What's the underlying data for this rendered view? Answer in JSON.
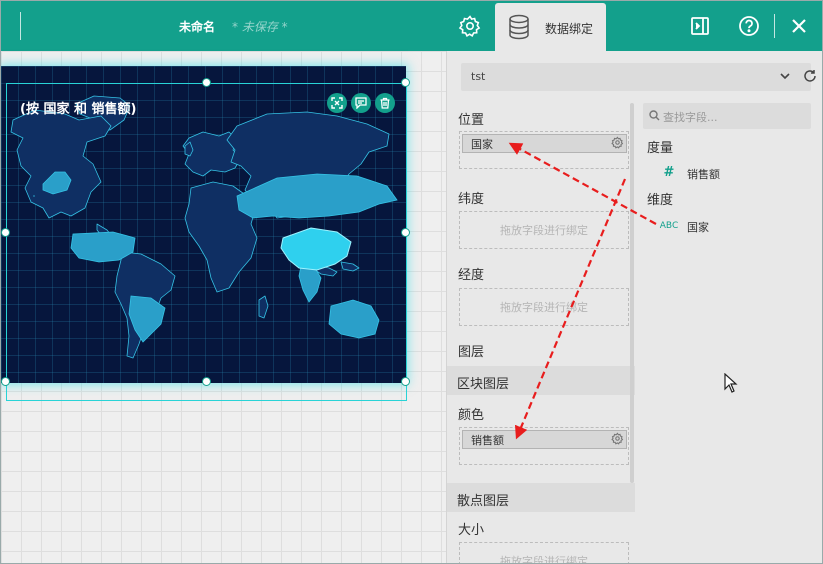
{
  "toolbar": {
    "doc_title": "未命名",
    "doc_status": "* 未保存 *",
    "active_tab_label": "数据绑定",
    "accent": "#13a08c",
    "icons": [
      "gear-icon",
      "database-icon",
      "panel-toggle-icon",
      "help-icon",
      "close-icon"
    ]
  },
  "map": {
    "title": "(按 国家 和 销售额)",
    "background": "#06163d",
    "highlight_color": "#2fd0ee",
    "tools": [
      "fullscreen-icon",
      "comment-icon",
      "trash-icon"
    ]
  },
  "dataset": {
    "selected": "tst"
  },
  "binding": {
    "location": {
      "label": "位置",
      "field": "国家"
    },
    "latitude": {
      "label": "纬度",
      "placeholder": "拖放字段进行绑定"
    },
    "longitude": {
      "label": "经度",
      "placeholder": "拖放字段进行绑定"
    },
    "layers_label": "图层",
    "region_layer": {
      "label": "区块图层"
    },
    "color": {
      "label": "颜色",
      "field": "销售额"
    },
    "scatter_layer": {
      "label": "散点图层"
    },
    "size": {
      "label": "大小",
      "placeholder": "拖放字段进行绑定"
    }
  },
  "fields": {
    "search_placeholder": "查找字段...",
    "measures_label": "度量",
    "measures": [
      {
        "type": "#",
        "name": "销售额"
      }
    ],
    "dimensions_label": "维度",
    "dimensions": [
      {
        "type": "ABC",
        "name": "国家"
      }
    ]
  }
}
